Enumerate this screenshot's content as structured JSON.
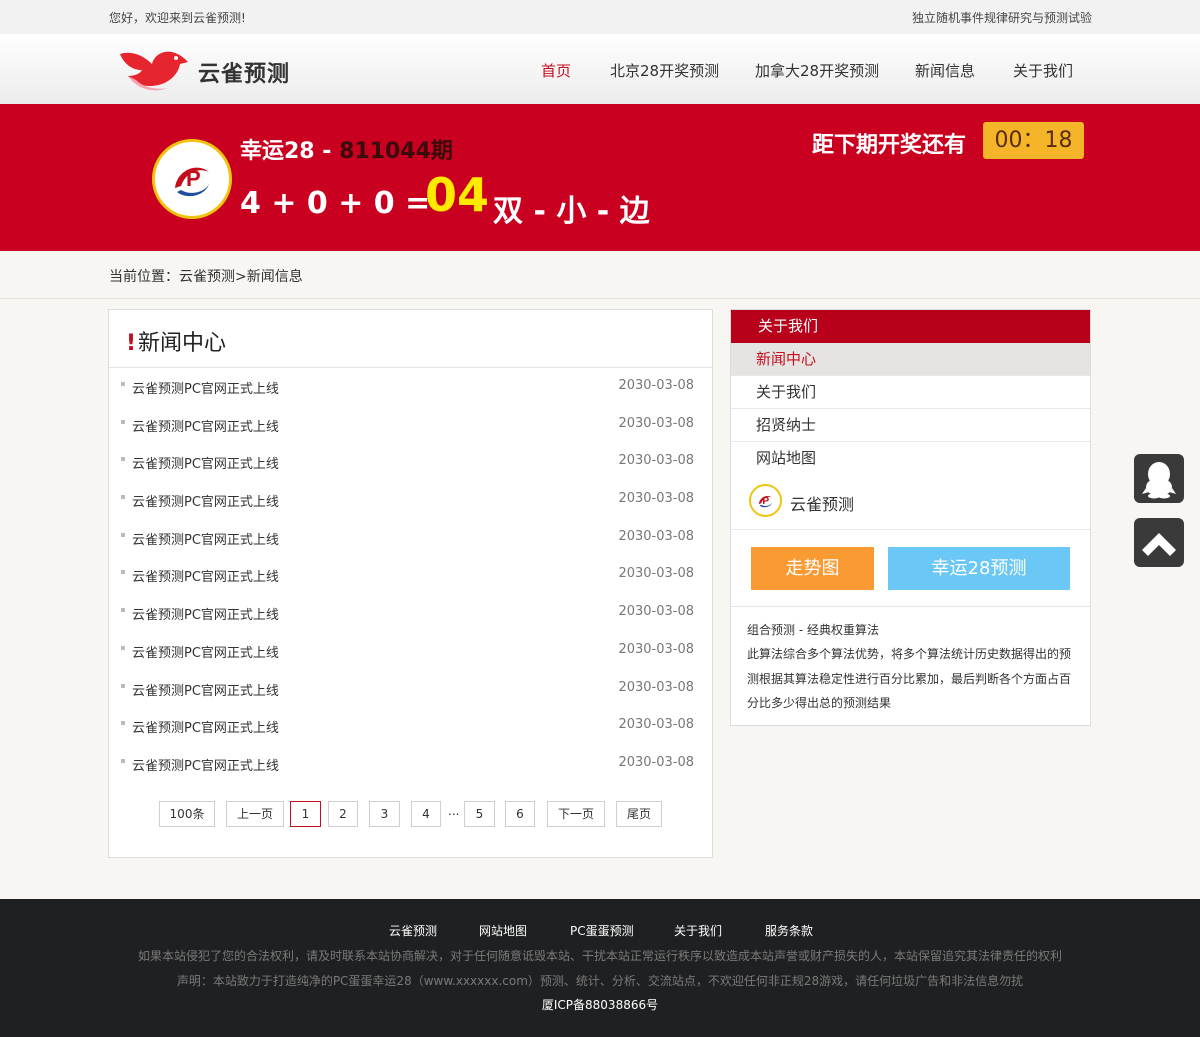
{
  "topbar": {
    "welcome": "您好，欢迎来到云雀预测!",
    "slogan": "独立随机事件规律研究与预测试验"
  },
  "header": {
    "logo_text": "云雀预测",
    "nav": [
      {
        "label": "首页",
        "active": true
      },
      {
        "label": "北京28开奖预测",
        "active": false
      },
      {
        "label": "加拿大28开奖预测",
        "active": false
      },
      {
        "label": "新闻信息",
        "active": false
      },
      {
        "label": "关于我们",
        "active": false
      }
    ]
  },
  "banner": {
    "game_name": "幸运28 - ",
    "period": "811044期",
    "formula": "4 + 0 + 0 =",
    "result": "04",
    "attributes": "双 - 小 - 边",
    "countdown_label": "距下期开奖还有",
    "countdown_value": "00：18"
  },
  "breadcrumb": {
    "prefix": "当前位置：",
    "home": "云雀预测",
    "separator": ">",
    "current": "新闻信息"
  },
  "news": {
    "heading_mark": "!",
    "heading": "新闻中心",
    "items": [
      {
        "title": "云雀预测PC官网正式上线",
        "date": "2030-03-08"
      },
      {
        "title": "云雀预测PC官网正式上线",
        "date": "2030-03-08"
      },
      {
        "title": "云雀预测PC官网正式上线",
        "date": "2030-03-08"
      },
      {
        "title": "云雀预测PC官网正式上线",
        "date": "2030-03-08"
      },
      {
        "title": "云雀预测PC官网正式上线",
        "date": "2030-03-08"
      },
      {
        "title": "云雀预测PC官网正式上线",
        "date": "2030-03-08"
      },
      {
        "title": "云雀预测PC官网正式上线",
        "date": "2030-03-08"
      },
      {
        "title": "云雀预测PC官网正式上线",
        "date": "2030-03-08"
      },
      {
        "title": "云雀预测PC官网正式上线",
        "date": "2030-03-08"
      },
      {
        "title": "云雀预测PC官网正式上线",
        "date": "2030-03-08"
      },
      {
        "title": "云雀预测PC官网正式上线",
        "date": "2030-03-08"
      }
    ],
    "pagination": {
      "total": "100条",
      "prev": "上一页",
      "pages": [
        "1",
        "2",
        "3",
        "4",
        "5",
        "6"
      ],
      "current": "1",
      "ellipsis": "...",
      "next": "下一页",
      "last": "尾页"
    }
  },
  "sidebar": {
    "heading": "关于我们",
    "items": [
      {
        "label": "新闻中心",
        "active": true
      },
      {
        "label": "关于我们",
        "active": false
      },
      {
        "label": "招贤纳士",
        "active": false
      },
      {
        "label": "网站地图",
        "active": false
      }
    ],
    "brand_name": "云雀预测",
    "trend_button": "走势图",
    "predict_button": "幸运28预测",
    "algo_title": "组合预测 - 经典权重算法",
    "algo_desc": "此算法综合多个算法优势，将多个算法统计历史数据得出的预测根据其算法稳定性进行百分比累加，最后判断各个方面占百分比多少得出总的预测结果"
  },
  "footer": {
    "links": [
      "云雀预测",
      "网站地图",
      "PC蛋蛋预测",
      "关于我们",
      "服务条款"
    ],
    "notice": "如果本站侵犯了您的合法权利，请及时联系本站协商解决，对于任何随意诋毁本站、干扰本站正常运行秩序以致造成本站声誉或财产损失的人，本站保留追究其法律责任的权利",
    "statement": "声明：本站致力于打造纯净的PC蛋蛋幸运28（www.xxxxxx.com）预测、统计、分析、交流站点，不欢迎任何非正规28游戏，请任何垃圾广告和非法信息勿扰",
    "icp": "厦ICP备88038866号"
  },
  "colors": {
    "brand_red": "#c90020",
    "accent_yellow": "#ffea00",
    "countdown_bg": "#f4b528",
    "trend_orange": "#fa9a33",
    "predict_blue": "#6bc7f5",
    "footer_bg": "#1f2022"
  }
}
